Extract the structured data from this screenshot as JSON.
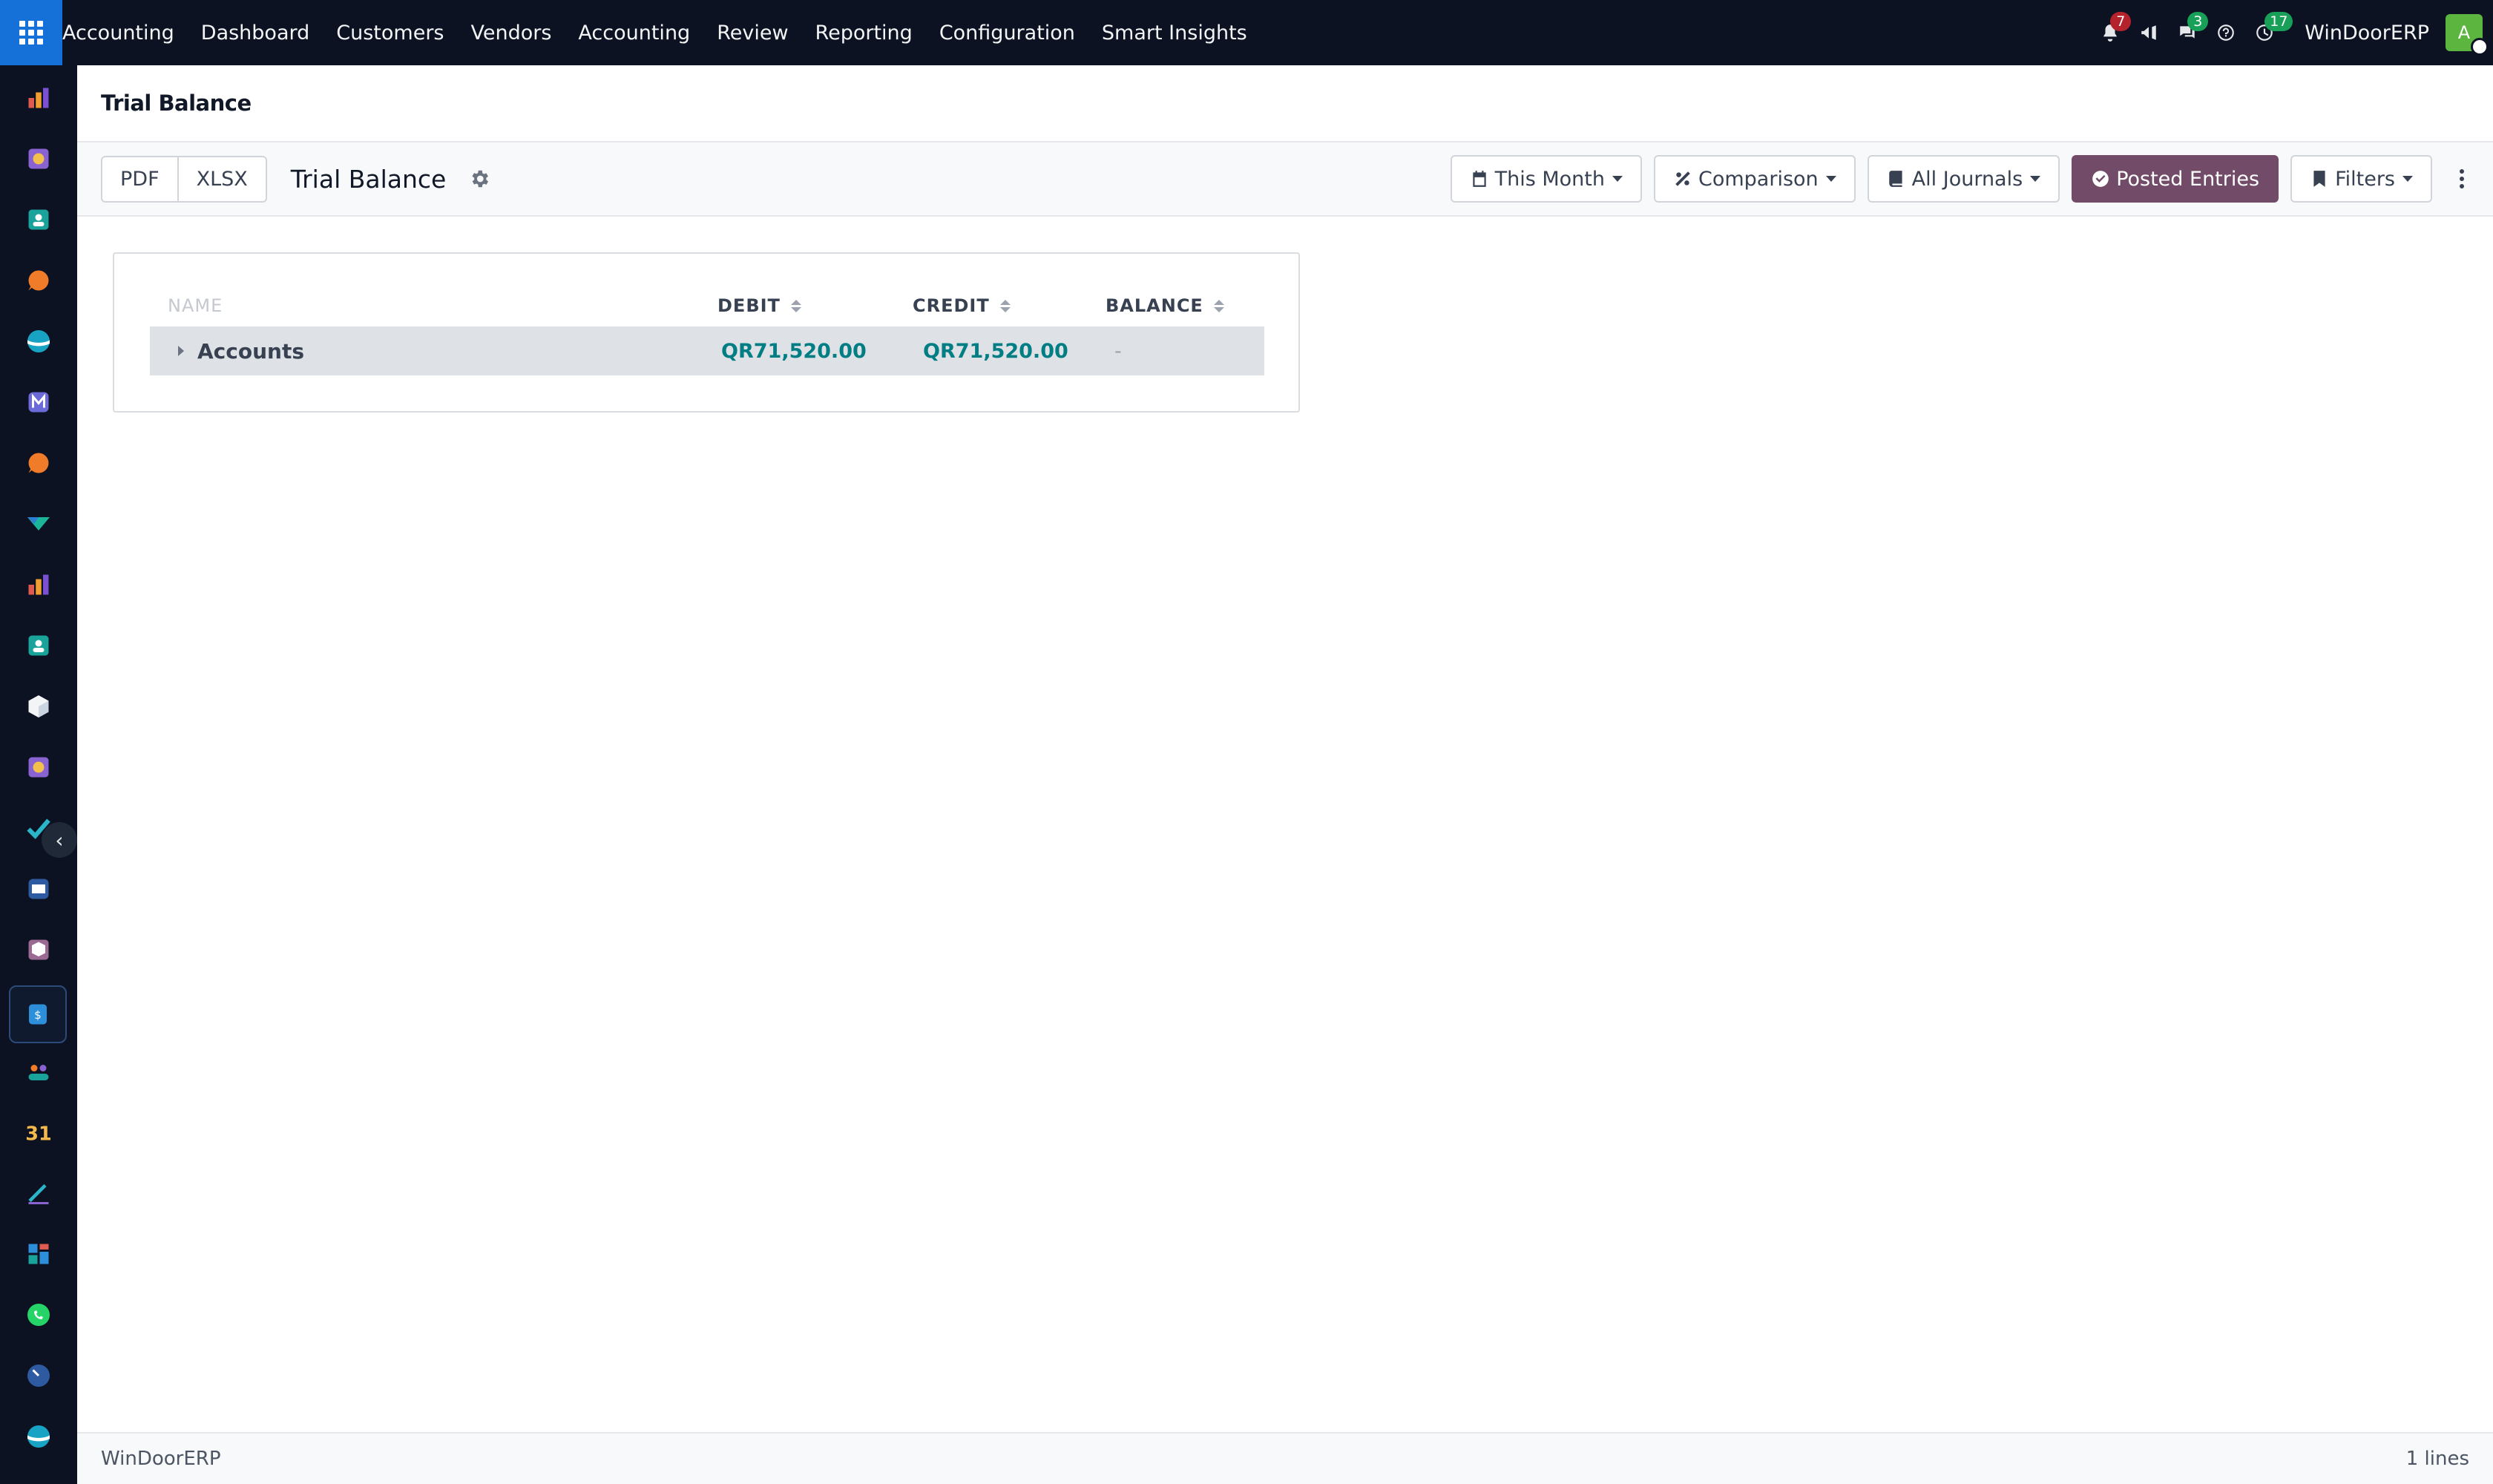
{
  "topbar": {
    "app_name": "Accounting",
    "menu": [
      "Dashboard",
      "Customers",
      "Vendors",
      "Accounting",
      "Review",
      "Reporting",
      "Configuration",
      "Smart Insights"
    ],
    "notifications_count": "7",
    "messages_count": "3",
    "activities_count": "17",
    "company": "WinDoorERP",
    "avatar_initial": "A"
  },
  "breadcrumb": "Trial Balance",
  "toolbar": {
    "pdf_label": "PDF",
    "xlsx_label": "XLSX",
    "report_title": "Trial Balance",
    "date_filter": "This Month",
    "comparison": "Comparison",
    "journals": "All Journals",
    "posted_entries": "Posted Entries",
    "filters": "Filters"
  },
  "table": {
    "headers": {
      "name": "NAME",
      "debit": "DEBIT",
      "credit": "CREDIT",
      "balance": "BALANCE"
    },
    "rows": [
      {
        "name": "Accounts",
        "debit": "QR71,520.00",
        "credit": "QR71,520.00",
        "balance": "-"
      }
    ]
  },
  "footer": {
    "company": "WinDoorERP",
    "lines": "1 lines"
  },
  "colors": {
    "navbar": "#0c1221",
    "apps_button": "#1570d8",
    "primary_button": "#714b67",
    "amount": "#017e84"
  }
}
